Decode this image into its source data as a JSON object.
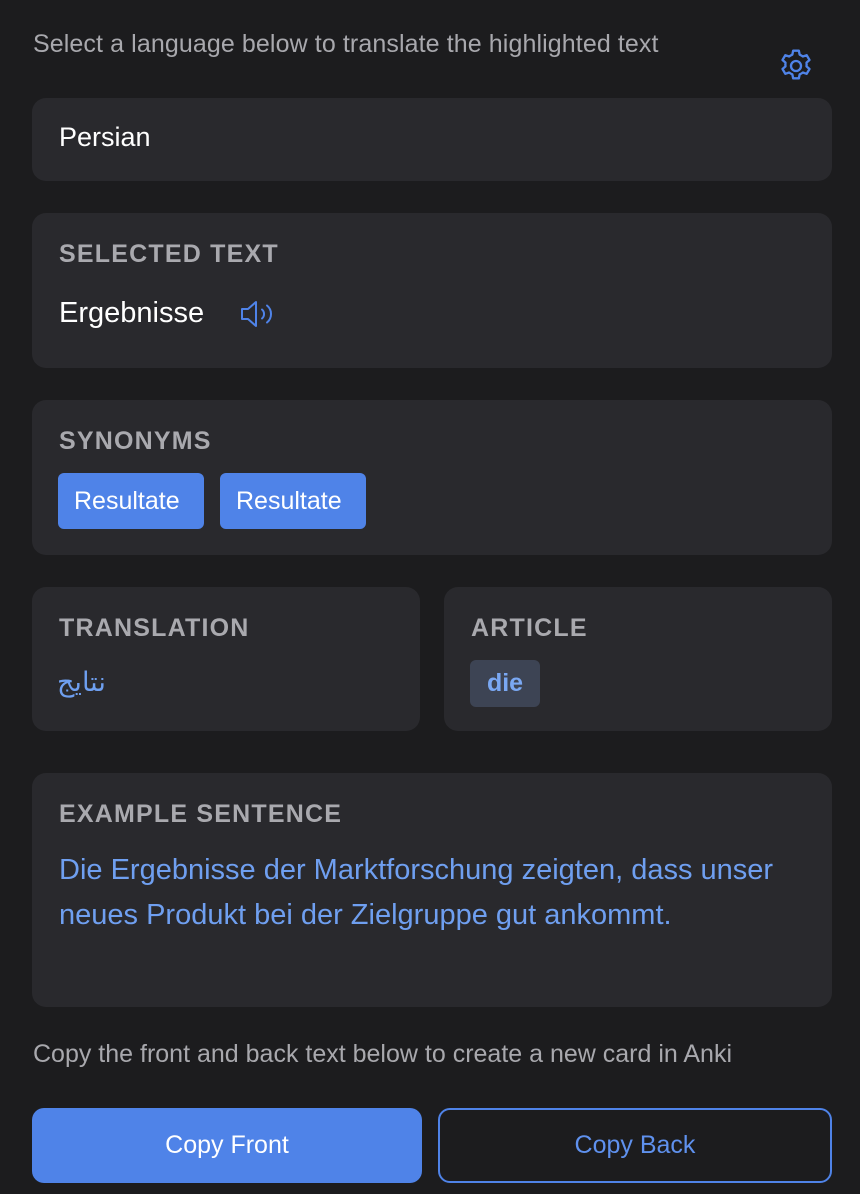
{
  "header": {
    "instruction": "Select a language below to translate the highlighted text",
    "settings_icon": "gear-icon"
  },
  "language_select": {
    "value": "Persian"
  },
  "selected_text": {
    "title": "SELECTED TEXT",
    "word": "Ergebnisse",
    "audio_icon": "speaker-icon"
  },
  "synonyms": {
    "title": "SYNONYMS",
    "items": [
      "Resultate",
      "Resultate"
    ]
  },
  "translation": {
    "title": "TRANSLATION",
    "value": "نتایج"
  },
  "article": {
    "title": "ARTICLE",
    "value": "die"
  },
  "example": {
    "title": "EXAMPLE SENTENCE",
    "sentence": "Die Ergebnisse der Marktforschung zeigten, dass unser neues Produkt bei der Zielgruppe gut ankommt."
  },
  "footer": {
    "instruction": "Copy the front and back text below to create a new card in Anki",
    "copy_front_label": "Copy Front",
    "copy_back_label": "Copy Back"
  },
  "colors": {
    "background": "#1c1c1e",
    "card": "#29292d",
    "accent": "#4f83e8",
    "accent_text": "#6f9ff0",
    "muted_text": "#a8a8ad"
  }
}
